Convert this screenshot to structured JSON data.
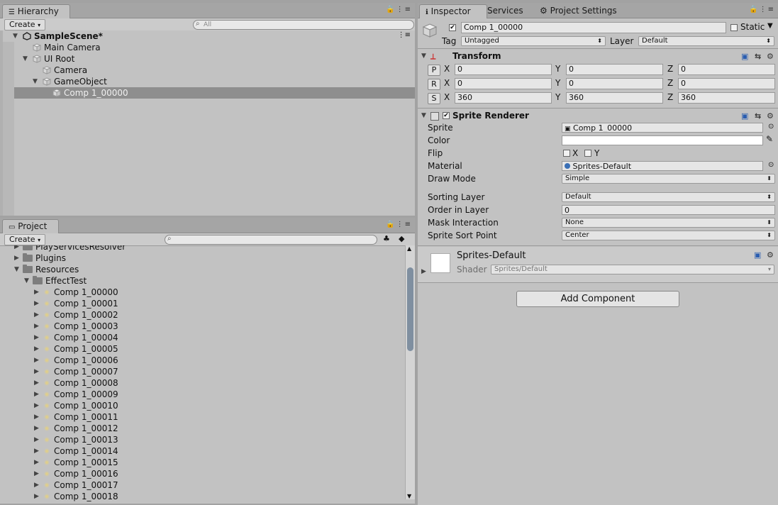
{
  "hierarchy": {
    "tab_label": "Hierarchy",
    "create_label": "Create",
    "search_placeholder": "All",
    "items": [
      {
        "label": "SampleScene*",
        "depth": 0,
        "bold": true,
        "scene": true,
        "expanded": true
      },
      {
        "label": "Main Camera",
        "depth": 1
      },
      {
        "label": "UI Root",
        "depth": 1,
        "expanded": true
      },
      {
        "label": "Camera",
        "depth": 2
      },
      {
        "label": "GameObject",
        "depth": 2,
        "expanded": true
      },
      {
        "label": "Comp 1_00000",
        "depth": 3,
        "selected": true
      }
    ]
  },
  "project": {
    "tab_label": "Project",
    "create_label": "Create",
    "folders": [
      {
        "label": "PlayServicesResolver",
        "depth": 0,
        "expanded": false
      },
      {
        "label": "Plugins",
        "depth": 0,
        "expanded": false
      },
      {
        "label": "Resources",
        "depth": 0,
        "expanded": true
      },
      {
        "label": "EffectTest",
        "depth": 1,
        "expanded": true
      }
    ],
    "assets": [
      "Comp 1_00000",
      "Comp 1_00001",
      "Comp 1_00002",
      "Comp 1_00003",
      "Comp 1_00004",
      "Comp 1_00005",
      "Comp 1_00006",
      "Comp 1_00007",
      "Comp 1_00008",
      "Comp 1_00009",
      "Comp 1_00010",
      "Comp 1_00011",
      "Comp 1_00012",
      "Comp 1_00013",
      "Comp 1_00014",
      "Comp 1_00015",
      "Comp 1_00016",
      "Comp 1_00017",
      "Comp 1_00018"
    ]
  },
  "inspector": {
    "tabs": {
      "inspector": "Inspector",
      "services": "Services",
      "project_settings": "Project Settings"
    },
    "object": {
      "name": "Comp 1_00000",
      "active": true,
      "static_label": "Static",
      "tag_label": "Tag",
      "tag_value": "Untagged",
      "layer_label": "Layer",
      "layer_value": "Default"
    },
    "transform": {
      "title": "Transform",
      "position": {
        "btn": "P",
        "x": "0",
        "y": "0",
        "z": "0"
      },
      "rotation": {
        "btn": "R",
        "x": "0",
        "y": "0",
        "z": "0"
      },
      "scale": {
        "btn": "S",
        "x": "360",
        "y": "360",
        "z": "360"
      },
      "axis_x": "X",
      "axis_y": "Y",
      "axis_z": "Z"
    },
    "sprite_renderer": {
      "title": "Sprite Renderer",
      "enabled": true,
      "sprite_label": "Sprite",
      "sprite_value": "Comp 1_00000",
      "color_label": "Color",
      "color_value": "#ffffff",
      "flip_label": "Flip",
      "flip_x": "X",
      "flip_y": "Y",
      "material_label": "Material",
      "material_value": "Sprites-Default",
      "draw_mode_label": "Draw Mode",
      "draw_mode_value": "Simple",
      "sorting_layer_label": "Sorting Layer",
      "sorting_layer_value": "Default",
      "order_label": "Order in Layer",
      "order_value": "0",
      "mask_label": "Mask Interaction",
      "mask_value": "None",
      "sort_point_label": "Sprite Sort Point",
      "sort_point_value": "Center"
    },
    "material": {
      "name": "Sprites-Default",
      "shader_label": "Shader",
      "shader_value": "Sprites/Default"
    },
    "add_component_label": "Add Component"
  }
}
